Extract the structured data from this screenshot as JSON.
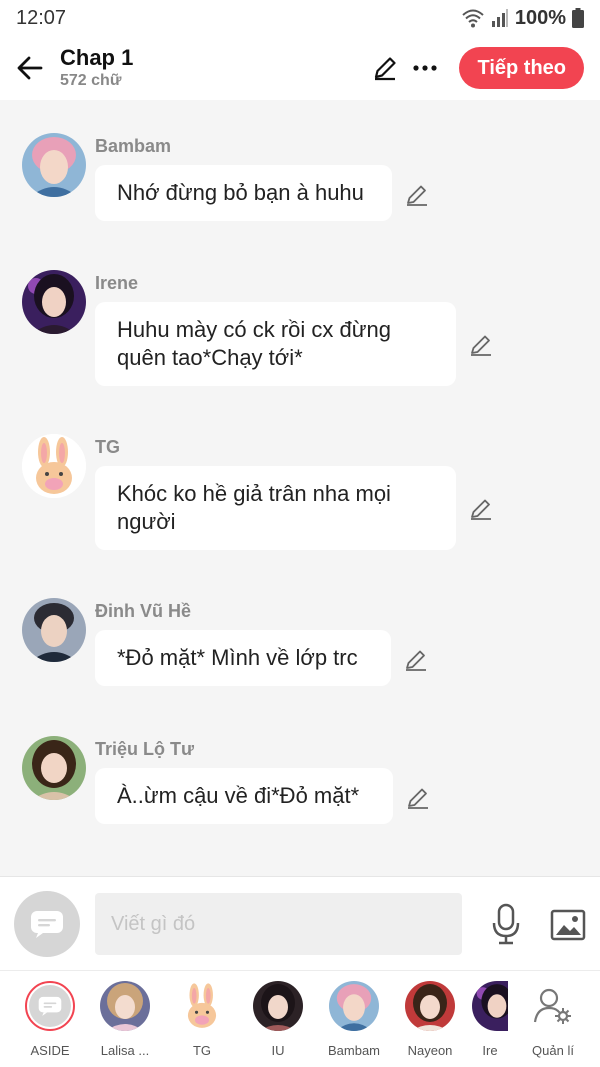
{
  "status_bar": {
    "time": "12:07",
    "battery": "100%"
  },
  "header": {
    "title": "Chap 1",
    "word_count": "572 chữ",
    "next_label": "Tiếp theo",
    "icons": [
      "back-arrow-icon",
      "pencil-icon",
      "more-icon"
    ]
  },
  "messages": [
    {
      "sender": "Bambam",
      "text": "Nhớ đừng bỏ bạn à huhu"
    },
    {
      "sender": "Irene",
      "text": "Huhu mày có ck rồi cx đừng quên tao*Chạy tới*"
    },
    {
      "sender": "TG",
      "text": "Khóc ko hề giả trân nha mọi người"
    },
    {
      "sender": "Đinh Vũ Hề",
      "text": "*Đỏ mặt* Mình về lớp trc"
    },
    {
      "sender": "Triệu Lộ Tư",
      "text": "À..ừm cậu về đi*Đỏ mặt*"
    }
  ],
  "composer": {
    "placeholder": "Viết gì đó",
    "icons": [
      "chat-bubble-icon",
      "microphone-icon",
      "image-icon"
    ]
  },
  "characters": [
    {
      "label": "ASIDE"
    },
    {
      "label": "Lalisa ..."
    },
    {
      "label": "TG"
    },
    {
      "label": "IU"
    },
    {
      "label": "Bambam"
    },
    {
      "label": "Nayeon"
    },
    {
      "label": "Ire"
    },
    {
      "label": "Quản lí"
    }
  ],
  "colors": {
    "accent": "#f24451",
    "background": "#f5f5f5",
    "bubble": "#ffffff",
    "muted": "#8a8a8a"
  }
}
